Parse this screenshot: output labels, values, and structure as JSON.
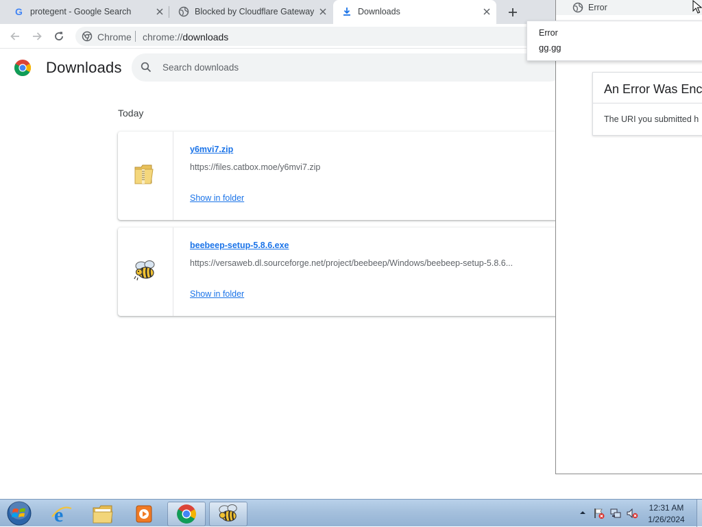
{
  "tabs": [
    {
      "title": "protegent - Google Search",
      "favicon": "google-g-icon"
    },
    {
      "title": "Blocked by Cloudflare Gateway",
      "favicon": "globe-icon"
    },
    {
      "title": "Downloads",
      "favicon": "download-arrow-icon",
      "active": true
    }
  ],
  "toolbar": {
    "site_label": "Chrome",
    "url_scheme": "chrome://",
    "url_host": "downloads"
  },
  "downloads": {
    "page_title": "Downloads",
    "search_placeholder": "Search downloads",
    "section_label": "Today",
    "items": [
      {
        "filename": "y6mvi7.zip",
        "url": "https://files.catbox.moe/y6mvi7.zip",
        "action": "Show in folder",
        "icon": "zip-folder-icon"
      },
      {
        "filename": "beebeep-setup-5.8.6.exe",
        "url": "https://versaweb.dl.sourceforge.net/project/beebeep/Windows/beebeep-setup-5.8.6...",
        "action": "Show in folder",
        "icon": "bee-app-icon"
      }
    ]
  },
  "popup": {
    "window_title": "Error",
    "tooltip_title": "Error",
    "tooltip_host": "gg.gg",
    "error_heading": "An Error Was Enc",
    "error_body": "The URI you submitted h"
  },
  "taskbar": {
    "pinned": [
      "start-orb",
      "internet-explorer-icon",
      "file-explorer-icon",
      "media-player-icon",
      "chrome-icon",
      "beebeep-icon"
    ],
    "time": "12:31 AM",
    "date": "1/26/2024"
  },
  "colors": {
    "link": "#1a73e8",
    "tabstrip": "#dee1e6",
    "taskbar": "#a5c0dd"
  }
}
